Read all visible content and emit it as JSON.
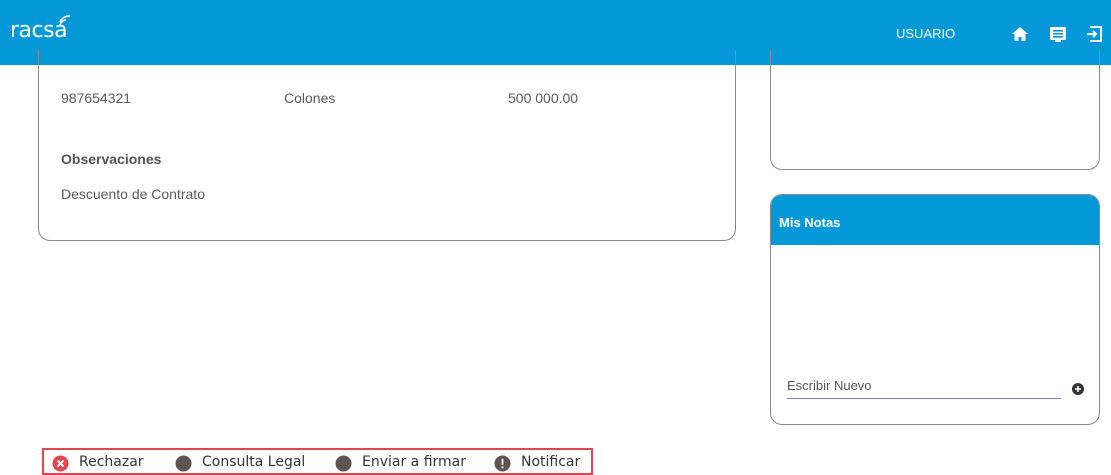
{
  "header": {
    "logo_text": "racsa",
    "user_label": "USUARIO",
    "icons": [
      "home-icon",
      "list-icon",
      "logout-icon"
    ],
    "brand_color": "#0598d8"
  },
  "detail": {
    "row": [
      "987654321",
      "Colones",
      "500 000.00"
    ],
    "observations_title": "Observaciones",
    "observations_text": "Descuento de Contrato"
  },
  "notes": {
    "title": "Mis Notas",
    "input_placeholder": "Escribir Nuevo"
  },
  "actions": [
    {
      "label": "Rechazar",
      "icon": "reject-icon",
      "color": "#e0474c"
    },
    {
      "label": "Consulta Legal",
      "icon": "status-dot-icon",
      "color": "#5e5552"
    },
    {
      "label": "Enviar a firmar",
      "icon": "status-dot-icon",
      "color": "#5e5552"
    },
    {
      "label": "Notificar",
      "icon": "alert-icon",
      "color": "#5e5552"
    }
  ]
}
